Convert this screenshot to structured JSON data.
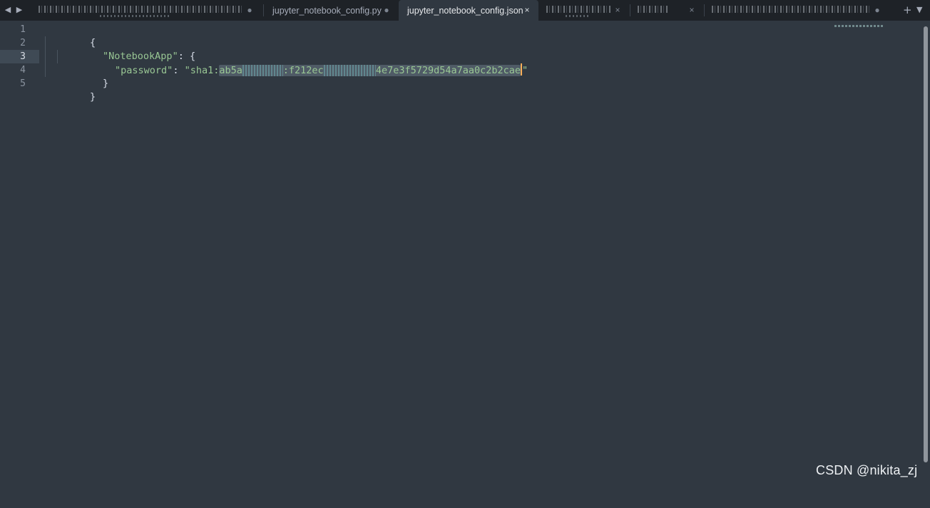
{
  "tabs": [
    {
      "label": "",
      "obscured": true,
      "state": "modified",
      "indicator": "●"
    },
    {
      "label": "jupyter_notebook_config.py",
      "state": "modified",
      "indicator": "●"
    },
    {
      "label": "jupyter_notebook_config.json",
      "state": "active",
      "indicator": "×"
    },
    {
      "label": "",
      "obscured": true,
      "state": "normal",
      "indicator": "×"
    },
    {
      "label": "",
      "obscured": true,
      "state": "normal",
      "indicator": "×"
    },
    {
      "label": "",
      "obscured": true,
      "state": "modified",
      "indicator": "●"
    }
  ],
  "tabbar": {
    "back": "◀",
    "forward": "▶",
    "new_tab": "+",
    "menu": "▼"
  },
  "editor": {
    "current_line": 3,
    "line_numbers": [
      "1",
      "2",
      "3",
      "4",
      "5"
    ],
    "lines": {
      "l1": "{",
      "l2_key": "\"NotebookApp\"",
      "l2_rest": ": {",
      "l3_key": "\"password\"",
      "l3_colon": ": ",
      "l3_prefix": "\"sha1:",
      "l3_hash_a": "ab5a",
      "l3_hash_redacted_1": "•••••••",
      "l3_hash_b": ":f212ec",
      "l3_hash_redacted_2": "•••••••••",
      "l3_hash_c": "4e7e3f5729d54a7aa0c2b2cae",
      "l3_suffix": "\"",
      "l4": "}",
      "l5": "}"
    }
  },
  "watermark": "CSDN @nikita_zj",
  "colors": {
    "background": "#303841",
    "tabbar": "#1e2227",
    "string": "#99c794",
    "caret": "#f9ae58",
    "selection": "#4f5b66"
  }
}
